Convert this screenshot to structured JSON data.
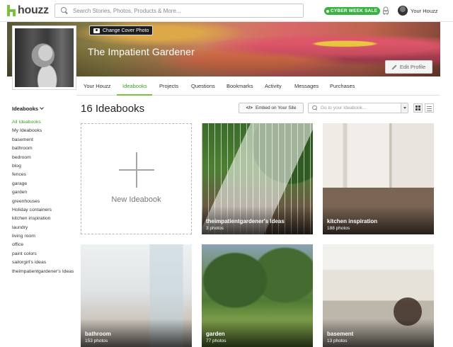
{
  "header": {
    "logo_text": "houzz",
    "search_placeholder": "Search Stories, Photos, Products & More...",
    "promo_badge": "CYBER WEEK SALE",
    "account_label": "Your Houzz"
  },
  "profile": {
    "name": "The Impatient Gardener",
    "change_cover_label": "Change Cover Photo",
    "edit_profile_label": "Edit Profile"
  },
  "nav": {
    "tabs": [
      "Your Houzz",
      "Ideabooks",
      "Projects",
      "Questions",
      "Bookmarks",
      "Activity",
      "Messages",
      "Purchases"
    ],
    "active_tab": "Ideabooks"
  },
  "sidebar": {
    "heading": "Ideabooks",
    "items": [
      "All Ideabooks",
      "My Ideabooks",
      "basement",
      "bathroom",
      "bedroom",
      "blog",
      "fences",
      "garage",
      "garden",
      "greenhouses",
      "Holiday containers",
      "kitchen inspiration",
      "laundry",
      "living room",
      "office",
      "paint colors",
      "sailorgirl's ideas",
      "theimpatientgardener's Ideas"
    ],
    "active_item": "All Ideabooks"
  },
  "main": {
    "title": "16 Ideabooks",
    "embed_label": "Embed on Your Site",
    "embed_icon": "</>",
    "goto_placeholder": "Go to your Ideabook...",
    "new_ideabook_label": "New Ideabook"
  },
  "ideabooks": [
    {
      "title": "theimpatientgardener's Ideas",
      "count": "3 photos"
    },
    {
      "title": "kitchen inspiration",
      "count": "188 photos"
    },
    {
      "title": "bathroom",
      "count": "153 photos"
    },
    {
      "title": "garden",
      "count": "77 photos"
    },
    {
      "title": "basement",
      "count": "13 photos"
    }
  ],
  "colors": {
    "brand_green": "#7ac142",
    "active_link": "#3a9d23",
    "promo_green": "#38b341"
  }
}
